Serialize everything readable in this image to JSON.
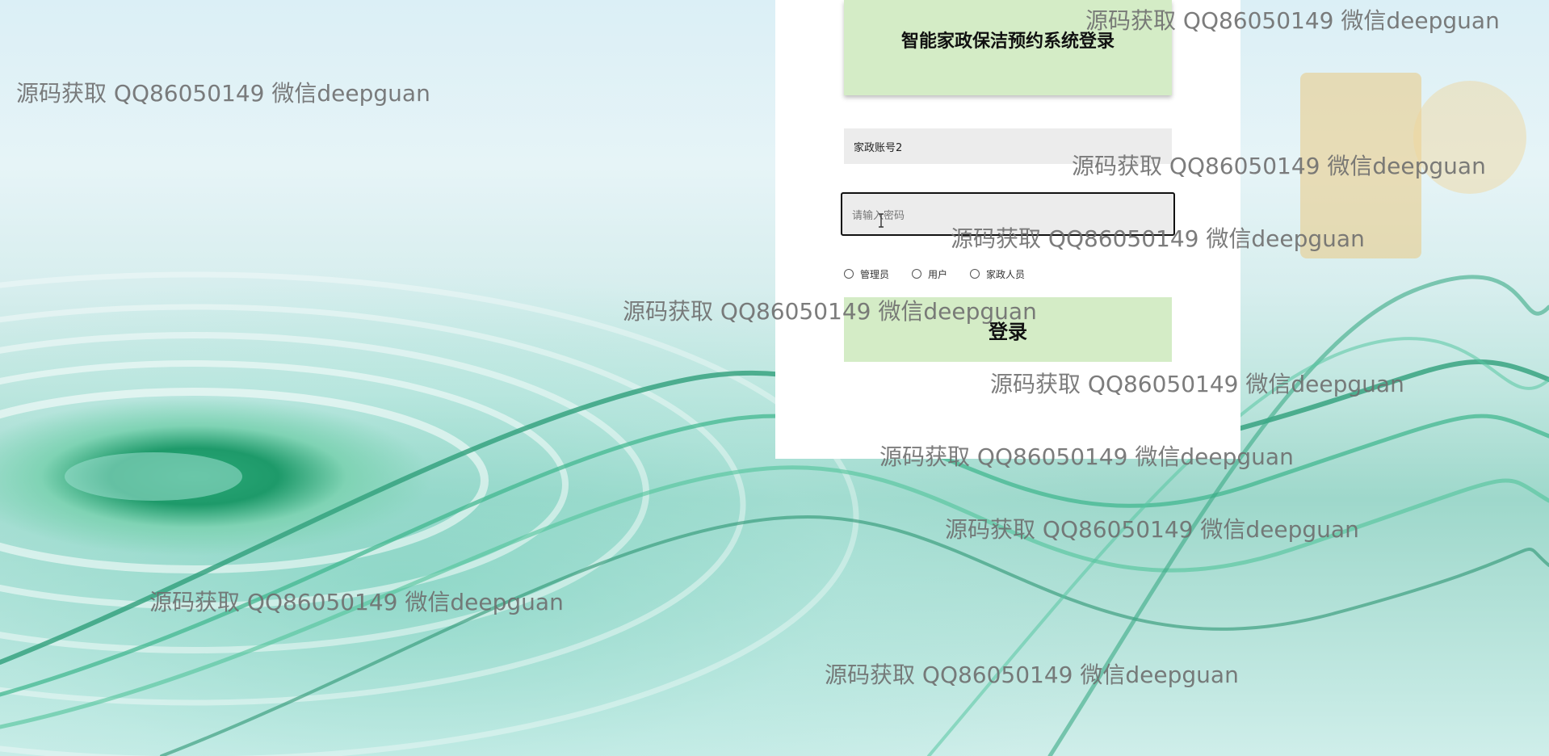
{
  "login": {
    "title": "智能家政保洁预约系统登录",
    "account_value": "家政账号2",
    "password_placeholder": "请输入密码",
    "roles": [
      "管理员",
      "用户",
      "家政人员"
    ],
    "login_label": "登录"
  },
  "watermark_text": "源码获取 QQ86050149 微信deepguan",
  "colors": {
    "accent_green": "#d4ecc6",
    "field_bg": "#ececec",
    "panel_bg": "#ffffff"
  }
}
